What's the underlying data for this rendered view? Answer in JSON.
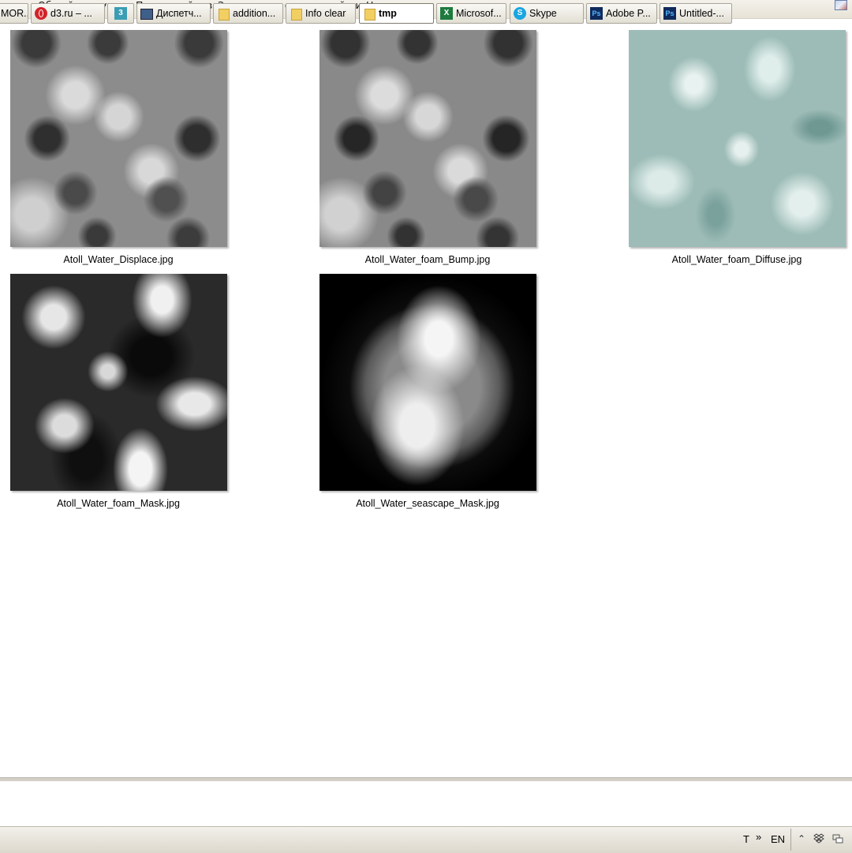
{
  "toolbar": {
    "partial_item": "ку",
    "share": "Общий доступ",
    "slideshow": "Показ слайдов",
    "burn": "Записать на оптический диск",
    "new_folder": "Новая папка",
    "views_icon": "view-options-icon"
  },
  "files": [
    {
      "name": "Atoll_Water_Displace.jpg",
      "thumb": "grayscale-displacement-texture"
    },
    {
      "name": "Atoll_Water_foam_Bump.jpg",
      "thumb": "grayscale-bump-texture"
    },
    {
      "name": "Atoll_Water_foam_Diffuse.jpg",
      "thumb": "teal-water-diffuse-texture"
    },
    {
      "name": "Atoll_Water_foam_Mask.jpg",
      "thumb": "black-white-foam-mask"
    },
    {
      "name": "Atoll_Water_seascape_Mask.jpg",
      "thumb": "circular-seascape-mask"
    }
  ],
  "taskbar": {
    "items": [
      {
        "label": "MOR...",
        "icon": "app-icon"
      },
      {
        "label": "d3.ru – ...",
        "icon": "opera-icon"
      },
      {
        "label": "3",
        "icon": "3dsmax-icon"
      },
      {
        "label": "Диспетч...",
        "icon": "task-manager-icon"
      },
      {
        "label": "addition...",
        "icon": "folder-icon"
      },
      {
        "label": "Info clear",
        "icon": "folder-icon"
      },
      {
        "label": "tmp",
        "icon": "folder-icon",
        "active": true
      },
      {
        "label": "Microsof...",
        "icon": "excel-icon"
      },
      {
        "label": "Skype",
        "icon": "skype-icon"
      },
      {
        "label": "Adobe P...",
        "icon": "photoshop-icon"
      },
      {
        "label": "Untitled-...",
        "icon": "photoshop-icon"
      }
    ],
    "tray": {
      "lang_prefix": "T",
      "chevron": "»",
      "lang": "EN",
      "icons": [
        "expand-tray-icon",
        "dropbox-icon"
      ]
    }
  }
}
